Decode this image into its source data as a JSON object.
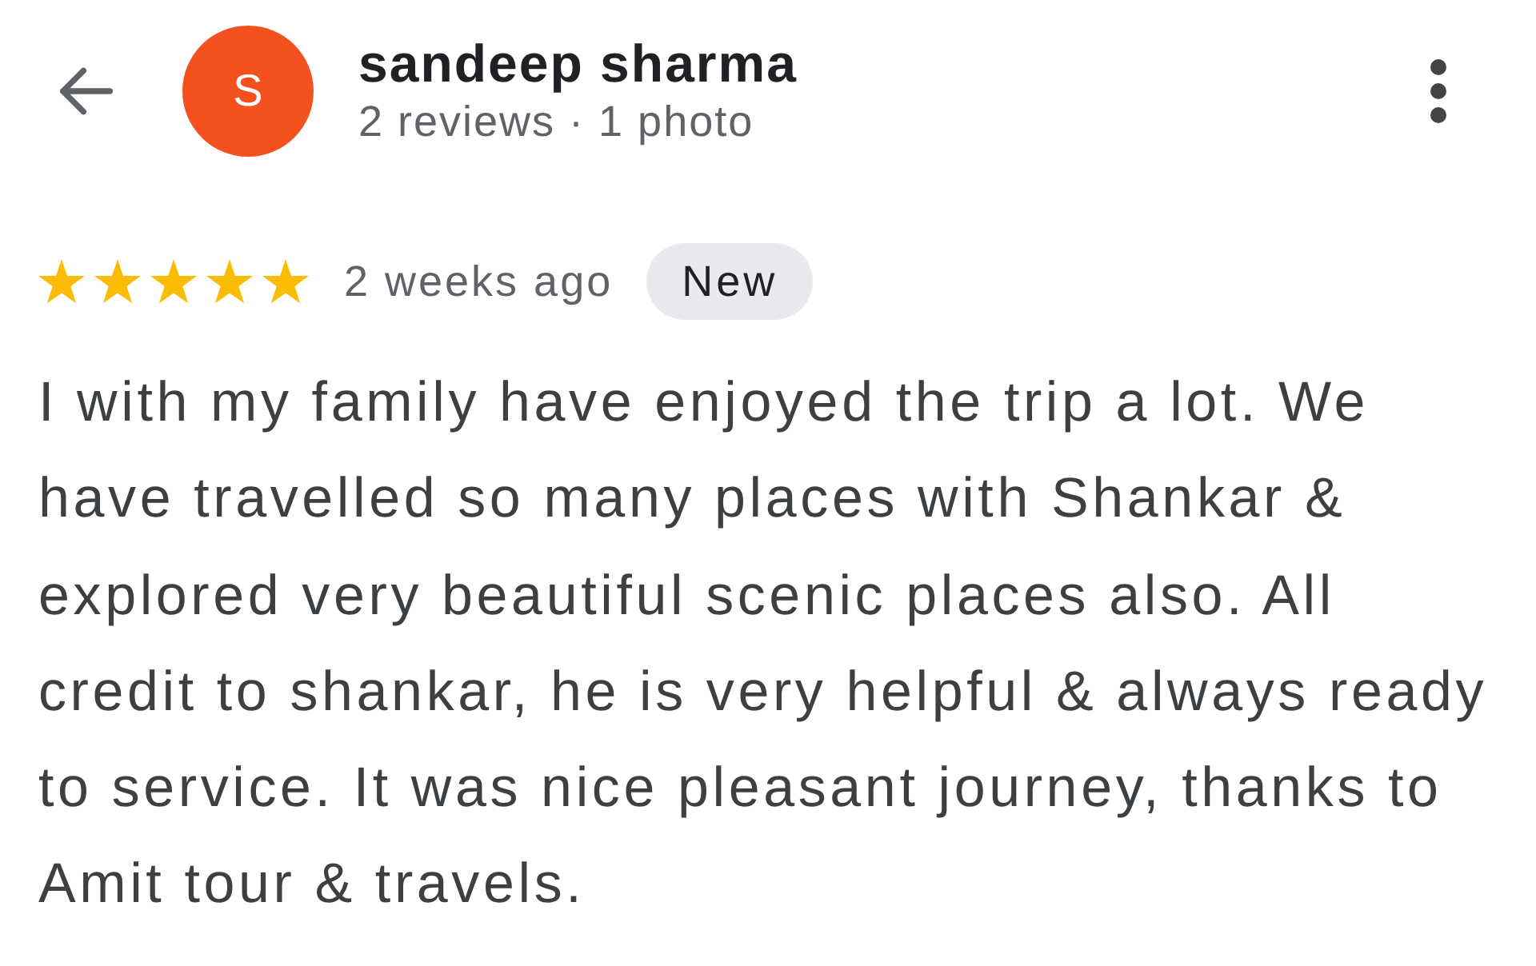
{
  "reviewer": {
    "initial": "S",
    "name": "sandeep sharma",
    "stats": "2 reviews · 1 photo"
  },
  "review": {
    "stars": 5,
    "time": "2 weeks ago",
    "badge": "New",
    "text": "I with my family have enjoyed the trip a lot. We have travelled so many places with Shankar & explored very beautiful scenic places also. All credit to shankar, he is very helpful & always ready to service. It was nice pleasant journey, thanks to Amit tour & travels."
  }
}
